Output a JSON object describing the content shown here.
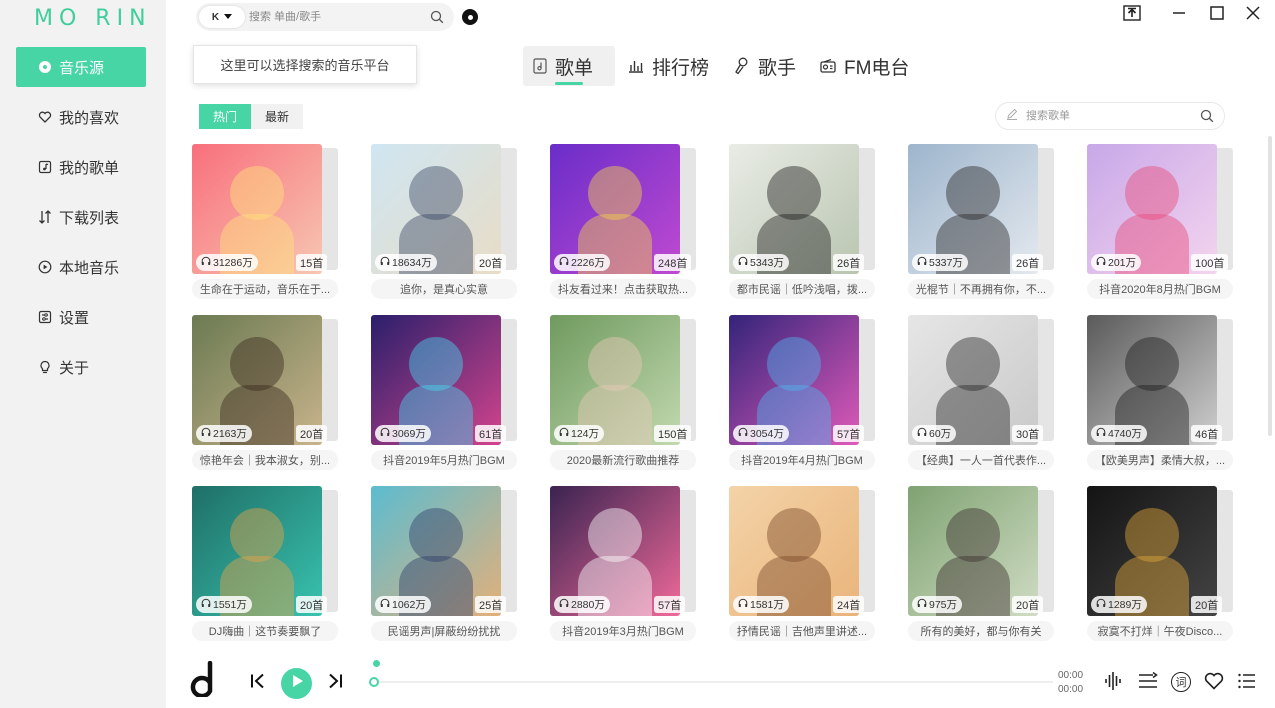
{
  "app": {
    "logo": "MO RIN"
  },
  "sidebar": {
    "items": [
      {
        "label": "音乐源",
        "icon": "disc-icon",
        "active": true
      },
      {
        "label": "我的喜欢",
        "icon": "heart-icon"
      },
      {
        "label": "我的歌单",
        "icon": "playlist-icon"
      },
      {
        "label": "下载列表",
        "icon": "download-icon"
      },
      {
        "label": "本地音乐",
        "icon": "local-play-icon"
      },
      {
        "label": "设置",
        "icon": "settings-icon"
      },
      {
        "label": "关于",
        "icon": "bulb-icon"
      }
    ]
  },
  "topbar": {
    "platform": "K",
    "search_placeholder": "搜索 单曲/歌手",
    "tooltip": "这里可以选择搜索的音乐平台"
  },
  "tabs": [
    {
      "label": "歌单",
      "icon": "playlist-tab-icon",
      "active": true
    },
    {
      "label": "排行榜",
      "icon": "chart-icon"
    },
    {
      "label": "歌手",
      "icon": "singer-icon"
    },
    {
      "label": "FM电台",
      "icon": "radio-icon"
    }
  ],
  "filters": [
    {
      "label": "热门",
      "active": true
    },
    {
      "label": "最新"
    }
  ],
  "list_search_placeholder": "搜索歌单",
  "playlists": [
    {
      "plays": "31286万",
      "count": "15首",
      "title": "生命在于运动，音乐在于...",
      "c1": "#f86f7c",
      "c2": "#f7c7b2",
      "c3": "#ffe27a"
    },
    {
      "plays": "18634万",
      "count": "20首",
      "title": "追你，是真心实意",
      "c1": "#cfe6f2",
      "c2": "#e8dcc6",
      "c3": "#3b4a66"
    },
    {
      "plays": "2226万",
      "count": "248首",
      "title": "抖友看过来！点击获取热...",
      "c1": "#6a2dc9",
      "c2": "#c04ad1",
      "c3": "#f3d34a"
    },
    {
      "plays": "5343万",
      "count": "26首",
      "title": "都市民谣｜低吟浅唱，拨...",
      "c1": "#e9ece6",
      "c2": "#b9c5b0",
      "c3": "#222222"
    },
    {
      "plays": "5337万",
      "count": "26首",
      "title": "光棍节｜不再拥有你，不...",
      "c1": "#9db5cc",
      "c2": "#e4e9ef",
      "c3": "#2c2a2a"
    },
    {
      "plays": "201万",
      "count": "100首",
      "title": "抖音2020年8月热门BGM",
      "c1": "#c8a8e8",
      "c2": "#f4d4ee",
      "c3": "#e84a7a"
    },
    {
      "plays": "2163万",
      "count": "20首",
      "title": "惊艳年会｜我本淑女，别...",
      "c1": "#6b7a52",
      "c2": "#c9b48c",
      "c3": "#3a2a1e"
    },
    {
      "plays": "3069万",
      "count": "61首",
      "title": "抖音2019年5月热门BGM",
      "c1": "#2a1f6b",
      "c2": "#d3448d",
      "c3": "#45d7f0"
    },
    {
      "plays": "124万",
      "count": "150首",
      "title": "2020最新流行歌曲推荐",
      "c1": "#6f9a5e",
      "c2": "#c2d9b0",
      "c3": "#e8c9b8"
    },
    {
      "plays": "3054万",
      "count": "57首",
      "title": "抖音2019年4月热门BGM",
      "c1": "#33247a",
      "c2": "#e05ab9",
      "c3": "#4fb3f0"
    },
    {
      "plays": "60万",
      "count": "30首",
      "title": "【经典】一人一首代表作...",
      "c1": "#e6e6e6",
      "c2": "#c9c9c9",
      "c3": "#2b2b2b"
    },
    {
      "plays": "4740万",
      "count": "46首",
      "title": "【欧美男声】柔情大叔，...",
      "c1": "#5a5a5a",
      "c2": "#cfcfcf",
      "c3": "#1e1e1e"
    },
    {
      "plays": "1551万",
      "count": "20首",
      "title": "DJ嗨曲｜这节奏要飘了",
      "c1": "#1f6f66",
      "c2": "#39c3b0",
      "c3": "#e7a54a"
    },
    {
      "plays": "1062万",
      "count": "25首",
      "title": "民谣男声|屏蔽纷纷扰扰",
      "c1": "#5bbcd0",
      "c2": "#e4b07a",
      "c3": "#2f3f6a"
    },
    {
      "plays": "2880万",
      "count": "57首",
      "title": "抖音2019年3月热门BGM",
      "c1": "#3a2350",
      "c2": "#f06a9a",
      "c3": "#ffffff"
    },
    {
      "plays": "1581万",
      "count": "24首",
      "title": "抒情民谣｜吉他声里讲述...",
      "c1": "#f4d3a8",
      "c2": "#e9b47a",
      "c3": "#7a4a2a"
    },
    {
      "plays": "975万",
      "count": "20首",
      "title": "所有的美好，都与你有关",
      "c1": "#7fa372",
      "c2": "#d0dcc4",
      "c3": "#3c2e2e"
    },
    {
      "plays": "1289万",
      "count": "20首",
      "title": "寂寞不打烊｜午夜Disco...",
      "c1": "#141414",
      "c2": "#444444",
      "c3": "#e0a93a"
    }
  ],
  "player": {
    "time_current": "00:00",
    "time_total": "00:00",
    "lyric_label": "词",
    "accent": "#47d5a6"
  }
}
